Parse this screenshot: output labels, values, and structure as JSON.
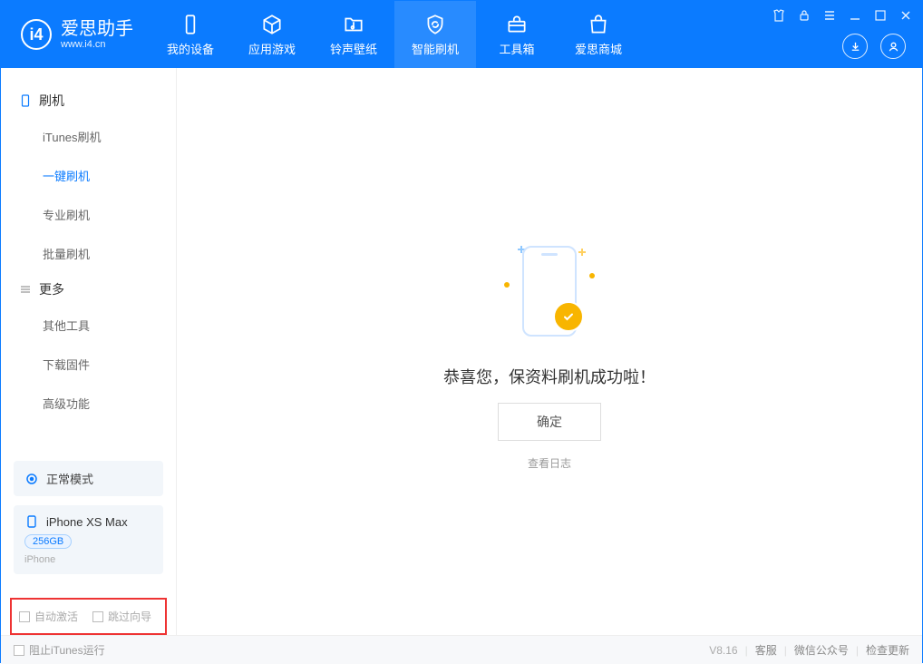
{
  "app": {
    "name_cn": "爱思助手",
    "name_en": "www.i4.cn"
  },
  "nav": [
    {
      "label": "我的设备"
    },
    {
      "label": "应用游戏"
    },
    {
      "label": "铃声壁纸"
    },
    {
      "label": "智能刷机"
    },
    {
      "label": "工具箱"
    },
    {
      "label": "爱思商城"
    }
  ],
  "sidebar": {
    "section1_title": "刷机",
    "section1_items": [
      {
        "label": "iTunes刷机"
      },
      {
        "label": "一键刷机"
      },
      {
        "label": "专业刷机"
      },
      {
        "label": "批量刷机"
      }
    ],
    "section2_title": "更多",
    "section2_items": [
      {
        "label": "其他工具"
      },
      {
        "label": "下载固件"
      },
      {
        "label": "高级功能"
      }
    ],
    "mode_label": "正常模式",
    "device_name": "iPhone XS Max",
    "device_storage": "256GB",
    "device_type": "iPhone",
    "checkbox1": "自动激活",
    "checkbox2": "跳过向导"
  },
  "main": {
    "success_text": "恭喜您，保资料刷机成功啦！",
    "confirm_label": "确定",
    "view_log_label": "查看日志"
  },
  "footer": {
    "block_itunes": "阻止iTunes运行",
    "version": "V8.16",
    "link1": "客服",
    "link2": "微信公众号",
    "link3": "检查更新"
  }
}
